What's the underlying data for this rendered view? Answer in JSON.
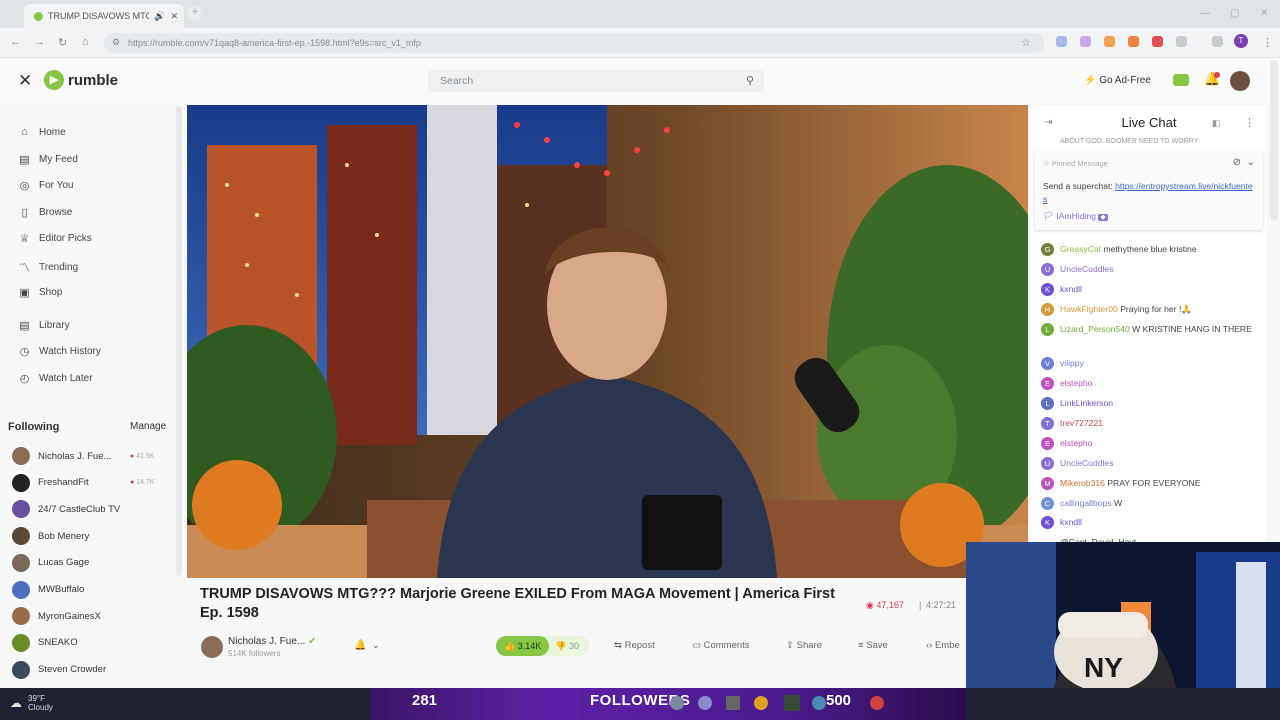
{
  "browser": {
    "tab_title": "TRUMP DISAVOWS MTG??? M",
    "url": "https://rumble.com/v71qaq8-america-first-ep.-1598.html?e9s=src_v1_mfp",
    "new_tab": "+"
  },
  "header": {
    "logo": "rumble",
    "search_placeholder": "Search",
    "ad_free_label": "Go Ad-Free"
  },
  "sidebar": {
    "nav": [
      {
        "label": "Home",
        "icon": "home-icon"
      },
      {
        "label": "My Feed",
        "icon": "feed-icon"
      },
      {
        "label": "For You",
        "icon": "for-you-icon"
      },
      {
        "label": "Browse",
        "icon": "browse-icon"
      },
      {
        "label": "Editor Picks",
        "icon": "editor-picks-icon"
      },
      {
        "label": "Trending",
        "icon": "trending-icon"
      },
      {
        "label": "Shop",
        "icon": "shop-icon"
      },
      {
        "label": "Library",
        "icon": "library-icon"
      },
      {
        "label": "Watch History",
        "icon": "history-icon"
      },
      {
        "label": "Watch Later",
        "icon": "clock-icon"
      }
    ],
    "following_title": "Following",
    "manage_label": "Manage",
    "following": [
      {
        "name": "Nicholas J. Fue...",
        "count": "41.5K",
        "live": true,
        "color": "#8a6b57"
      },
      {
        "name": "FreshandFit",
        "count": "14.7K",
        "live": true,
        "color": "#222222"
      },
      {
        "name": "24/7 CastleClub TV",
        "count": "",
        "live": false,
        "color": "#6b4fa0"
      },
      {
        "name": "Bob Menery",
        "count": "",
        "live": false,
        "color": "#5a4a3a"
      },
      {
        "name": "Lucas Gage",
        "count": "",
        "live": false,
        "color": "#7a6a5a"
      },
      {
        "name": "MWBuffalo",
        "count": "",
        "live": false,
        "color": "#4f6fc0"
      },
      {
        "name": "MyronGainesX",
        "count": "",
        "live": false,
        "color": "#9a6a4a"
      },
      {
        "name": "SNEAKO",
        "count": "",
        "live": false,
        "color": "#6b8c2a"
      },
      {
        "name": "Steven Crowder",
        "count": "",
        "live": false,
        "color": "#3a4a5a"
      }
    ]
  },
  "video": {
    "title": "TRUMP DISAVOWS MTG??? Marjorie Greene EXILED From MAGA Movement | America First Ep. 1598",
    "views": "47,167",
    "separator": "|",
    "duration": "4:27:21",
    "channel": "Nicholas J. Fue...",
    "channel_followers": "514K followers",
    "likes": "3.14K",
    "dislikes": "30",
    "repost": "Repost",
    "comments": "Comments",
    "share": "Share",
    "save": "Save",
    "embed": "Embe"
  },
  "chat": {
    "title": "Live Chat",
    "top_text": "ABOUT GOD. BOOMER NEED TO WORRY",
    "pinned_label": "Pinned Message",
    "pinned_prefix": "Send a superchat: ",
    "pinned_link": "https://entropystream.live/nickfuentes",
    "pinned_user": "IAmHiding",
    "messages": [
      {
        "user": "GreasyCat",
        "text": "methythene blue kristine",
        "color": "#85c742",
        "badge": "G",
        "bcolor": "#6f7f3a"
      },
      {
        "user": "UncleCuddles",
        "text": "",
        "color": "#8b6fd6",
        "badge": "U",
        "bcolor": "#8b6fd6"
      },
      {
        "user": "kxndll",
        "text": "",
        "color": "#6f4fd6",
        "badge": "K",
        "bcolor": "#6f4fd6"
      },
      {
        "user": "HawkFighter00",
        "text": "Praying for her !🙏",
        "color": "#d49a3a",
        "badge": "H",
        "bcolor": "#d49a3a"
      },
      {
        "user": "Lizard_Person540",
        "text": "W KRISTINE HANG IN THERE",
        "color": "#6fae3a",
        "badge": "L",
        "bcolor": "#6fae3a"
      },
      {
        "user": "vilippy",
        "text": "",
        "color": "#6f7fd6",
        "badge": "V",
        "bcolor": "#6f7fd6"
      },
      {
        "user": "elstepho",
        "text": "",
        "color": "#c04fc0",
        "badge": "E",
        "bcolor": "#c04fc0"
      },
      {
        "user": "LinkLinkerson",
        "text": "",
        "color": "#6f4fd6",
        "badge": "L",
        "bcolor": "#5f6fc0"
      },
      {
        "user": "trev727221",
        "text": "",
        "color": "#c04f4f",
        "badge": "T",
        "bcolor": "#7f6fd6"
      },
      {
        "user": "elstepho",
        "text": "",
        "color": "#c04fc0",
        "badge": "E",
        "bcolor": "#c04fc0"
      },
      {
        "user": "UncleCuddles",
        "text": "",
        "color": "#8b6fd6",
        "badge": "U",
        "bcolor": "#8b6fd6"
      },
      {
        "user": "Mikerob316",
        "text": "PRAY FOR EVERYONE",
        "color": "#d06f2a",
        "badge": "M",
        "bcolor": "#c04fc0"
      },
      {
        "user": "callingallbops",
        "text": "W",
        "color": "#6f7fd6",
        "badge": "C",
        "bcolor": "#6f8fd6"
      },
      {
        "user": "kxndll",
        "text": "",
        "color": "#6f4fd6",
        "badge": "K",
        "bcolor": "#6f4fd6"
      }
    ],
    "partial_message": "@Capt_David_Hoyt"
  },
  "stream_overlay": {
    "followers_count": "281",
    "followers_label": "FOLLOWERS",
    "goal": "500",
    "weather_temp": "39°F",
    "weather_desc": "Cloudy"
  }
}
